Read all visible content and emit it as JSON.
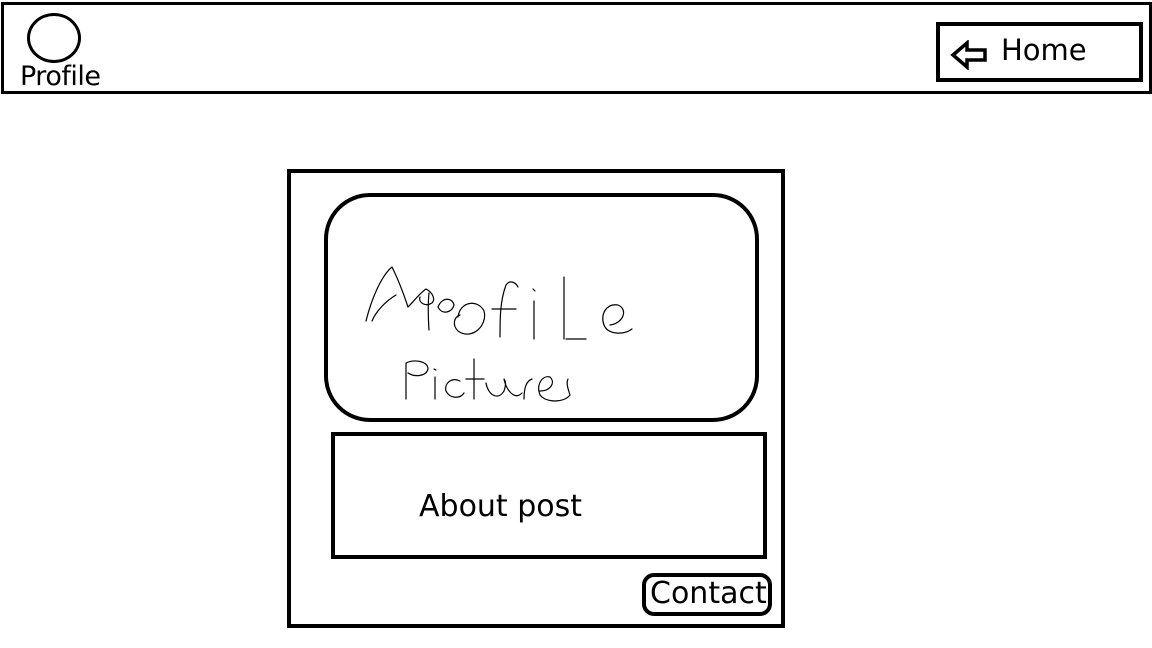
{
  "topbar": {
    "profile_label": "Profile",
    "profile_icon": "user-circle-icon",
    "home_label": "Home",
    "home_icon": "back-arrow-icon"
  },
  "card": {
    "picture_placeholder": "Profile picture",
    "about_label": "About post",
    "contact_label": "Contact"
  }
}
